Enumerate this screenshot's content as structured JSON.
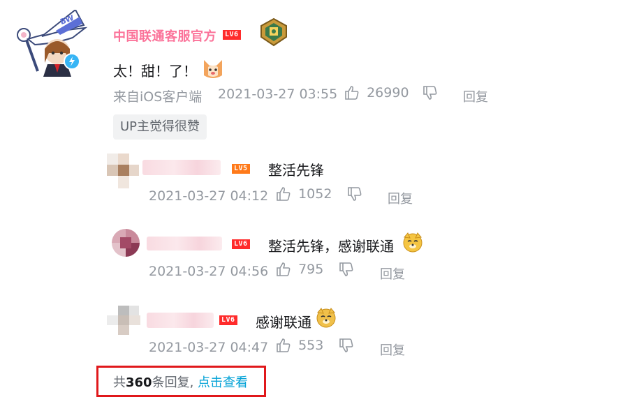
{
  "main_comment": {
    "username": "中国联通客服官方",
    "level": "LV6",
    "avatar_badge": "BW",
    "text": "太！甜！了！",
    "source": "来自iOS客户端",
    "timestamp": "2021-03-27 03:55",
    "likes": "26990",
    "reply_label": "回复",
    "up_tag": "UP主觉得很赞"
  },
  "replies": [
    {
      "level": "LV5",
      "text": "整活先锋",
      "timestamp": "2021-03-27 04:12",
      "likes": "1052",
      "reply_label": "回复"
    },
    {
      "level": "LV6",
      "text": "整活先锋，感谢联通",
      "timestamp": "2021-03-27 04:56",
      "likes": "795",
      "reply_label": "回复"
    },
    {
      "level": "LV6",
      "text": "感谢联通",
      "timestamp": "2021-03-27 04:47",
      "likes": "553",
      "reply_label": "回复"
    }
  ],
  "more": {
    "prefix": "共",
    "count": "360",
    "suffix": "条回复,",
    "link": "点击查看"
  },
  "colors": {
    "username": "#fb7299",
    "level6": "#ff2b2b",
    "level5": "#ff7a1a",
    "link": "#00a1d6",
    "highlight_box": "#e0181b"
  }
}
